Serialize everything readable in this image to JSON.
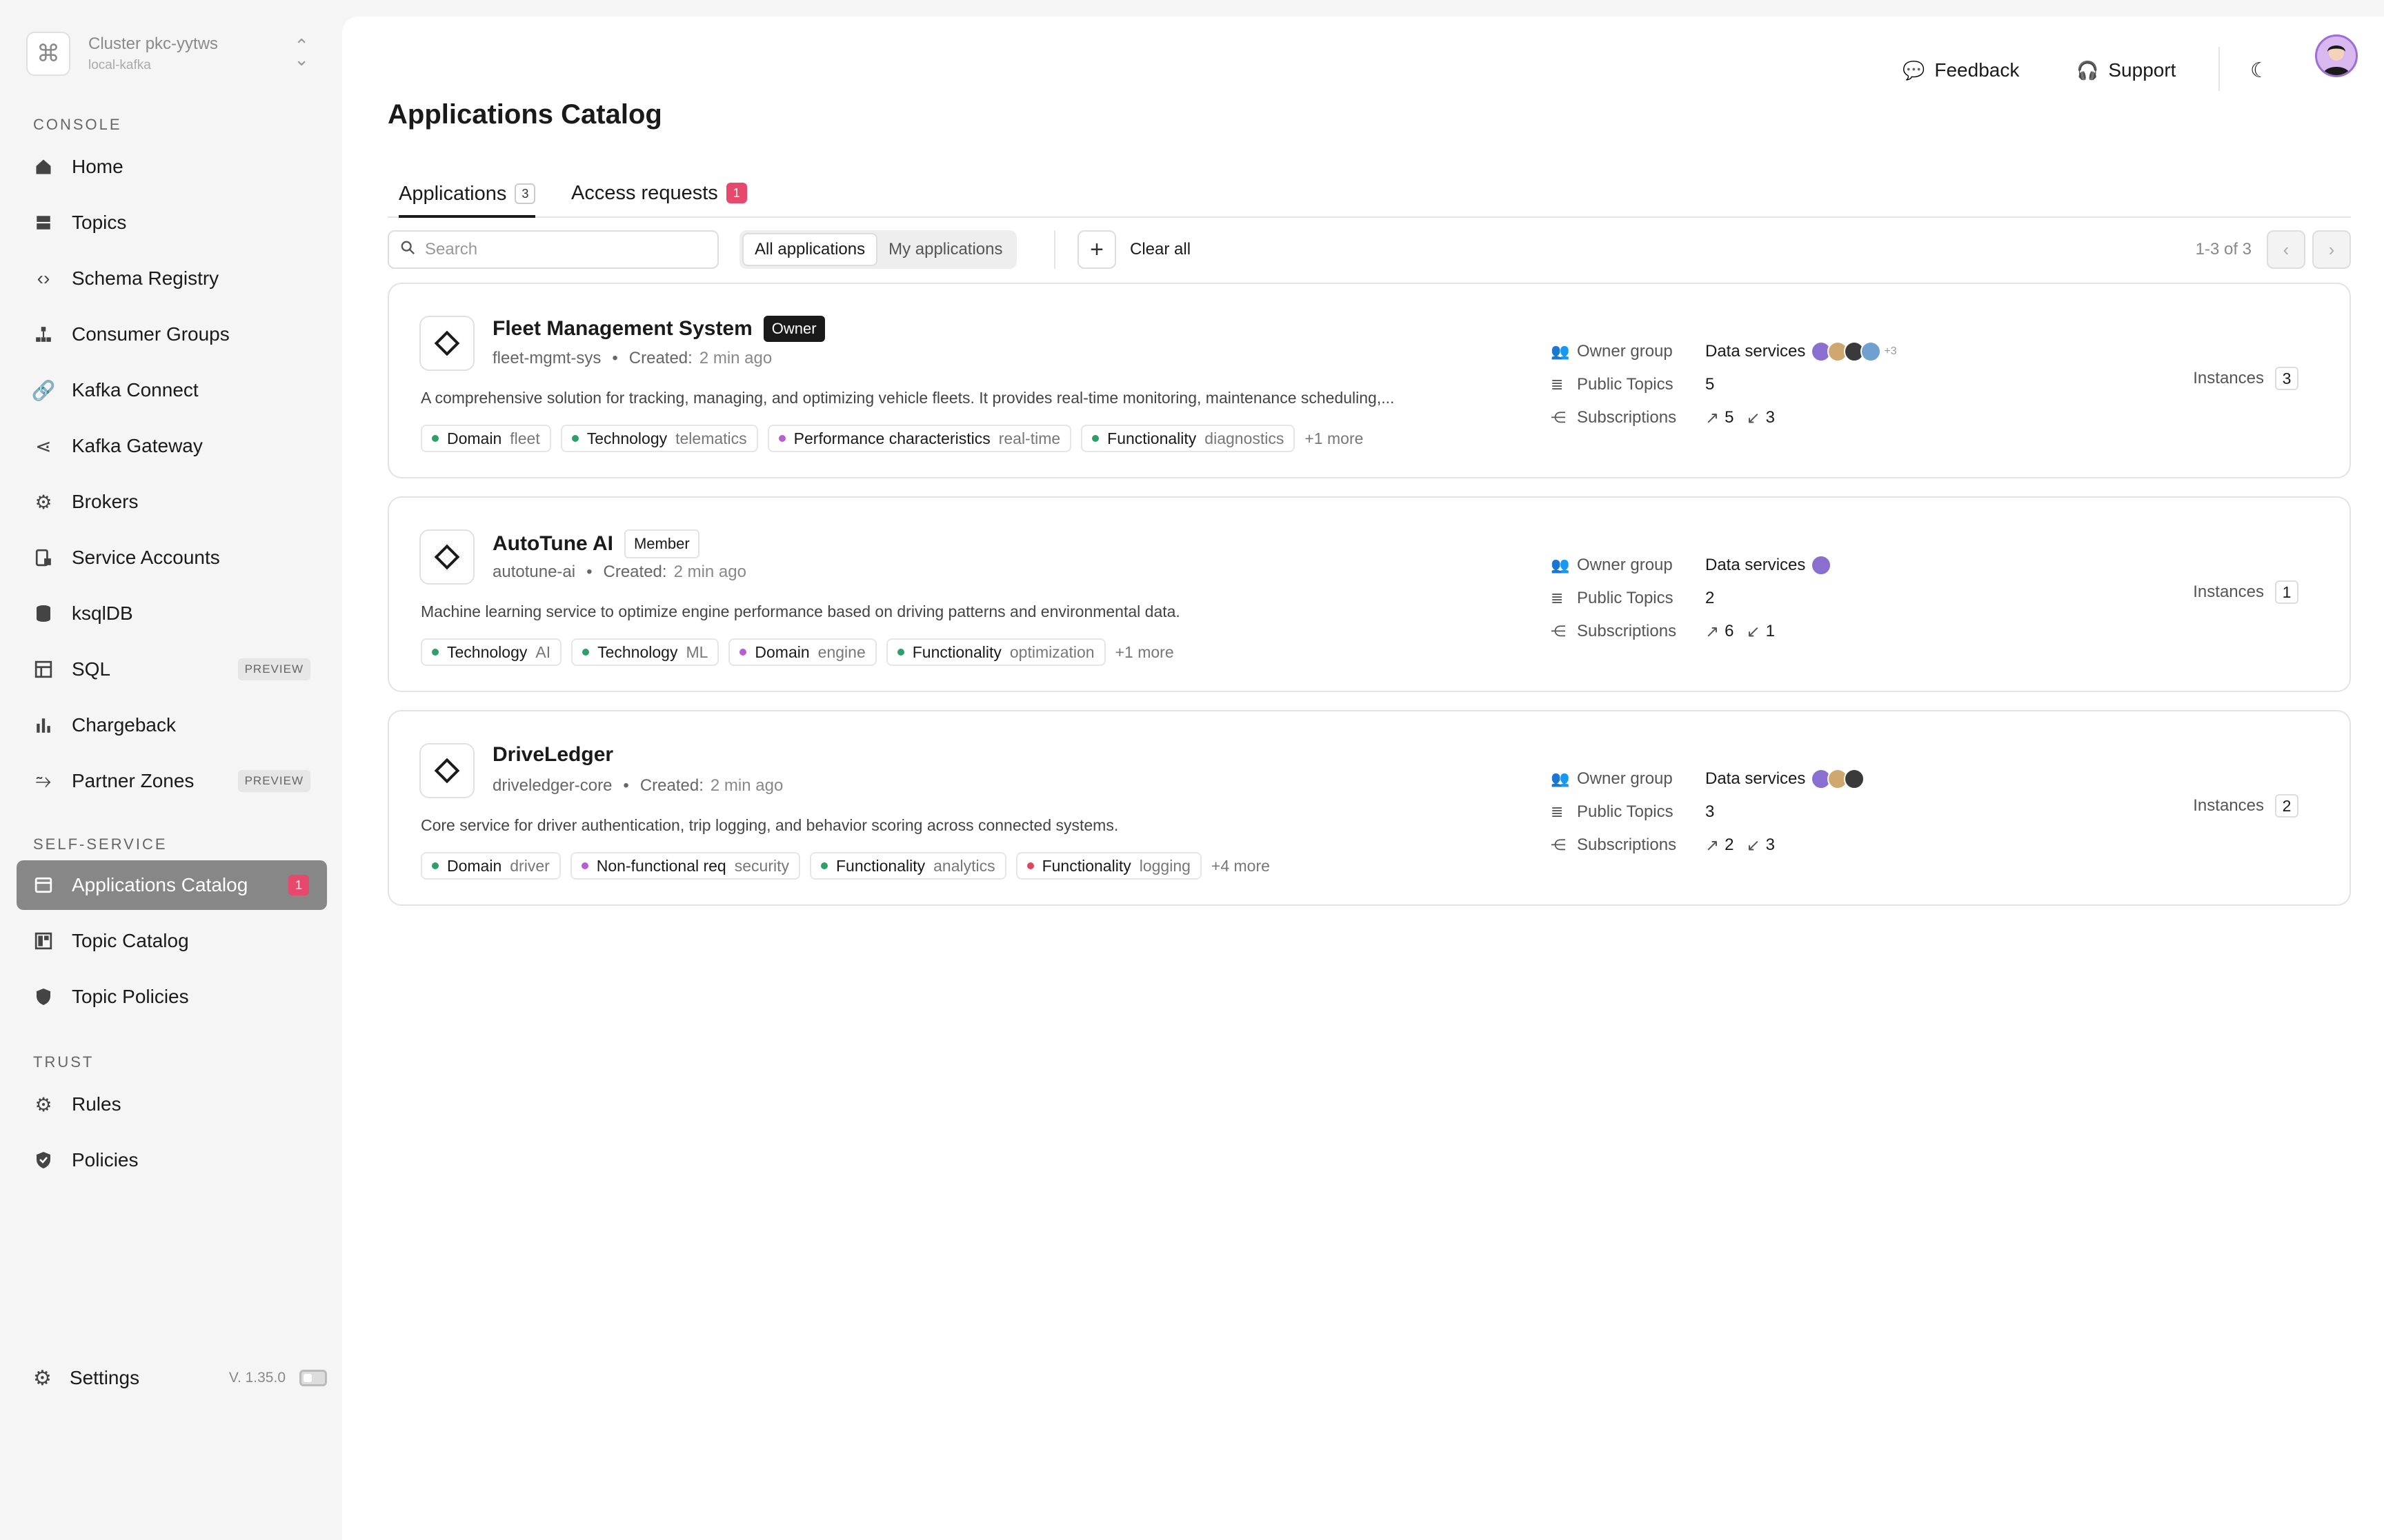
{
  "cluster": {
    "name": "Cluster pkc-yytws",
    "sub": "local-kafka"
  },
  "sidebar": {
    "console_label": "CONSOLE",
    "console_items": [
      {
        "label": "Home",
        "icon": "home-icon"
      },
      {
        "label": "Topics",
        "icon": "topics-icon"
      },
      {
        "label": "Schema Registry",
        "icon": "code-icon"
      },
      {
        "label": "Consumer Groups",
        "icon": "groups-icon"
      },
      {
        "label": "Kafka Connect",
        "icon": "link-icon"
      },
      {
        "label": "Kafka Gateway",
        "icon": "gateway-icon"
      },
      {
        "label": "Brokers",
        "icon": "brokers-icon"
      },
      {
        "label": "Service Accounts",
        "icon": "account-icon"
      },
      {
        "label": "ksqlDB",
        "icon": "database-icon"
      },
      {
        "label": "SQL",
        "icon": "table-icon",
        "badge": "PREVIEW"
      },
      {
        "label": "Chargeback",
        "icon": "chart-icon"
      },
      {
        "label": "Partner Zones",
        "icon": "zones-icon",
        "badge": "PREVIEW"
      }
    ],
    "self_service_label": "SELF-SERVICE",
    "self_service_items": [
      {
        "label": "Applications Catalog",
        "icon": "catalog-icon",
        "count": "1"
      },
      {
        "label": "Topic Catalog",
        "icon": "topic-catalog-icon"
      },
      {
        "label": "Topic Policies",
        "icon": "shield-icon"
      }
    ],
    "trust_label": "TRUST",
    "trust_items": [
      {
        "label": "Rules",
        "icon": "rules-icon"
      },
      {
        "label": "Policies",
        "icon": "policies-icon"
      }
    ],
    "settings_label": "Settings",
    "version": "V. 1.35.0"
  },
  "topbar": {
    "feedback": "Feedback",
    "support": "Support"
  },
  "page": {
    "title": "Applications Catalog"
  },
  "tabs": [
    {
      "label": "Applications",
      "count": "3"
    },
    {
      "label": "Access requests",
      "count": "1"
    }
  ],
  "filters": {
    "search_placeholder": "Search",
    "all_apps": "All applications",
    "my_apps": "My applications",
    "clear_all": "Clear all",
    "pager": "1-3 of 3"
  },
  "labels": {
    "created": "Created:",
    "owner_group": "Owner group",
    "public_topics": "Public Topics",
    "subscriptions": "Subscriptions",
    "instances": "Instances"
  },
  "apps": [
    {
      "name": "Fleet Management System",
      "role": "Owner",
      "id": "fleet-mgmt-sys",
      "created": "2 min ago",
      "description": "A comprehensive solution for tracking, managing, and optimizing vehicle fleets. It provides real-time monitoring, maintenance scheduling,...",
      "tags": [
        {
          "k": "Domain",
          "v": "fleet",
          "color": "#2e9e6b"
        },
        {
          "k": "Technology",
          "v": "telematics",
          "color": "#2e9e6b"
        },
        {
          "k": "Performance characteristics",
          "v": "real-time",
          "color": "#b65fd0"
        },
        {
          "k": "Functionality",
          "v": "diagnostics",
          "color": "#2e9e6b"
        }
      ],
      "more": "+1 more",
      "owner_group": "Data services",
      "avatar_more": "+3",
      "public_topics": "5",
      "subs_out": "5",
      "subs_in": "3",
      "instances": "3"
    },
    {
      "name": "AutoTune AI",
      "role": "Member",
      "id": "autotune-ai",
      "created": "2 min ago",
      "description": "Machine learning service to optimize engine performance based on driving patterns and environmental data.",
      "tags": [
        {
          "k": "Technology",
          "v": "AI",
          "color": "#2e9e6b"
        },
        {
          "k": "Technology",
          "v": "ML",
          "color": "#2e9e6b"
        },
        {
          "k": "Domain",
          "v": "engine",
          "color": "#b65fd0"
        },
        {
          "k": "Functionality",
          "v": "optimization",
          "color": "#2e9e6b"
        }
      ],
      "more": "+1 more",
      "owner_group": "Data services",
      "avatar_more": "",
      "public_topics": "2",
      "subs_out": "6",
      "subs_in": "1",
      "instances": "1"
    },
    {
      "name": "DriveLedger",
      "role": "",
      "id": "driveledger-core",
      "created": "2 min ago",
      "description": "Core service for driver authentication, trip logging, and behavior scoring across connected systems.",
      "tags": [
        {
          "k": "Domain",
          "v": "driver",
          "color": "#2e9e6b"
        },
        {
          "k": "Non-functional req",
          "v": "security",
          "color": "#b65fd0"
        },
        {
          "k": "Functionality",
          "v": "analytics",
          "color": "#2e9e6b"
        },
        {
          "k": "Functionality",
          "v": "logging",
          "color": "#e0465f"
        }
      ],
      "more": "+4 more",
      "owner_group": "Data services",
      "avatar_more": "",
      "public_topics": "3",
      "subs_out": "2",
      "subs_in": "3",
      "instances": "2"
    }
  ]
}
